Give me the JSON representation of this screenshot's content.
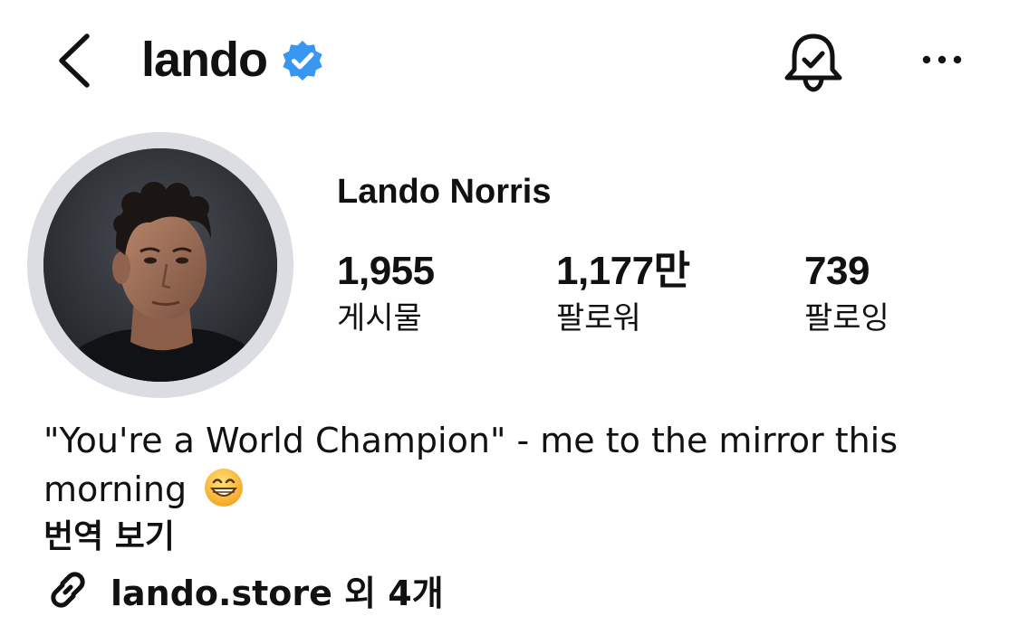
{
  "header": {
    "username": "lando",
    "verified_icon": "verified-badge-icon",
    "verified_color": "#3897f0"
  },
  "profile": {
    "display_name": "Lando Norris",
    "stats": [
      {
        "value": "1,955",
        "label": "게시물"
      },
      {
        "value": "1,177만",
        "label": "팔로워"
      },
      {
        "value": "739",
        "label": "팔로잉"
      }
    ]
  },
  "bio": {
    "text": "\"You're a World Champion\" - me to the mirror this morning",
    "emoji": "grinning-face-icon",
    "translate_label": "번역 보기",
    "link_label": "lando.store 외 4개"
  }
}
